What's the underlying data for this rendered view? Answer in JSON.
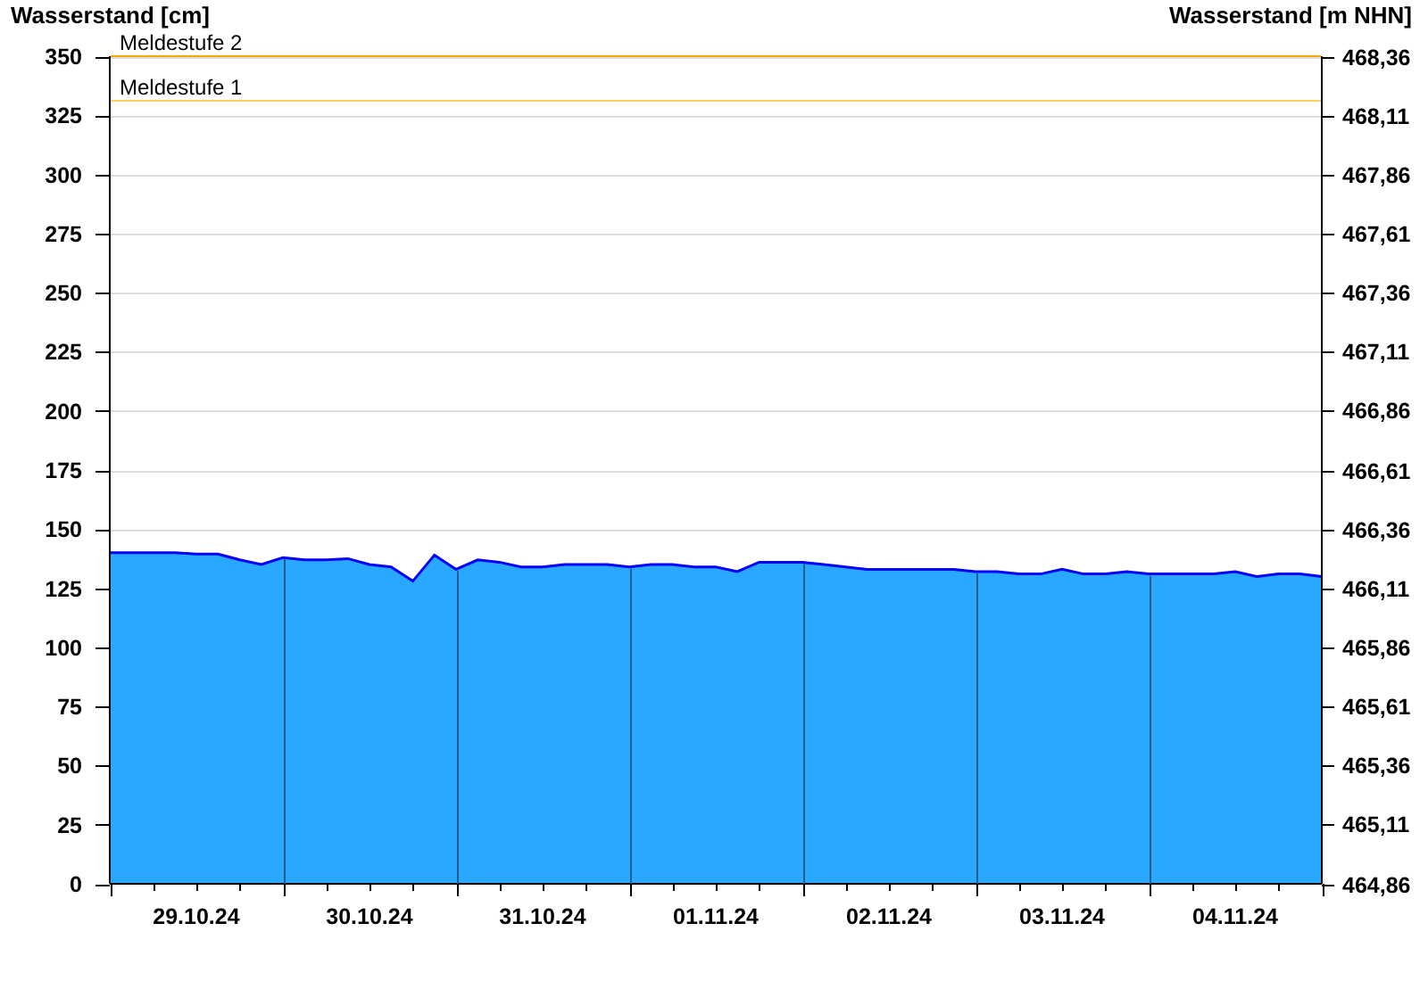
{
  "chart": {
    "chart_data": {
      "type": "area",
      "ylabel": "Wasserstand [cm]",
      "categories": [
        null,
        null,
        null,
        null,
        "29.10.24",
        null,
        null,
        null,
        null,
        null,
        null,
        null,
        "30.10.24",
        null,
        null,
        null,
        null,
        null,
        null,
        null,
        "31.10.24",
        null,
        null,
        null,
        null,
        null,
        null,
        null,
        "01.11.24",
        null,
        null,
        null,
        null,
        null,
        null,
        null,
        "02.11.24",
        null,
        null,
        null,
        null,
        null,
        null,
        null,
        "03.11.24",
        null,
        null,
        null,
        null,
        null,
        null,
        null,
        "04.11.24",
        null,
        null,
        null,
        null
      ],
      "series": [
        {
          "color": "#29a8ff",
          "values": [
            140,
            140,
            140,
            140,
            139.5,
            139.5,
            137,
            135,
            138,
            137,
            137,
            137.5,
            135,
            134,
            128,
            139,
            133,
            137,
            136,
            134,
            134,
            135,
            135,
            135,
            134,
            135,
            135,
            134,
            134,
            132,
            136,
            136,
            136,
            135,
            134,
            133,
            133,
            133,
            133,
            133,
            132,
            132,
            131,
            131,
            133,
            131,
            131,
            132,
            131,
            131,
            131,
            131,
            132,
            130,
            131,
            131,
            130
          ]
        }
      ],
      "ylim": [
        0,
        350
      ],
      "yticks": [
        0,
        25,
        50,
        75,
        100,
        125,
        150,
        175,
        200,
        225,
        250,
        275,
        300,
        325,
        350
      ],
      "grid": true
    },
    "thresholds": [
      {
        "label": "Meldestufe 2",
        "color": "#ffa500"
      },
      {
        "label": "Meldestufe 1",
        "color": "#ffd060"
      }
    ],
    "right_axis": {
      "title": "Wasserstand [m NHN]",
      "ticks": [
        "468,36",
        "468,11",
        "467,86",
        "467,61",
        "467,36",
        "467,11",
        "466,86",
        "466,61",
        "466,36",
        "466,11",
        "465,86",
        "465,61",
        "465,36",
        "465,11",
        "464,86"
      ]
    }
  }
}
